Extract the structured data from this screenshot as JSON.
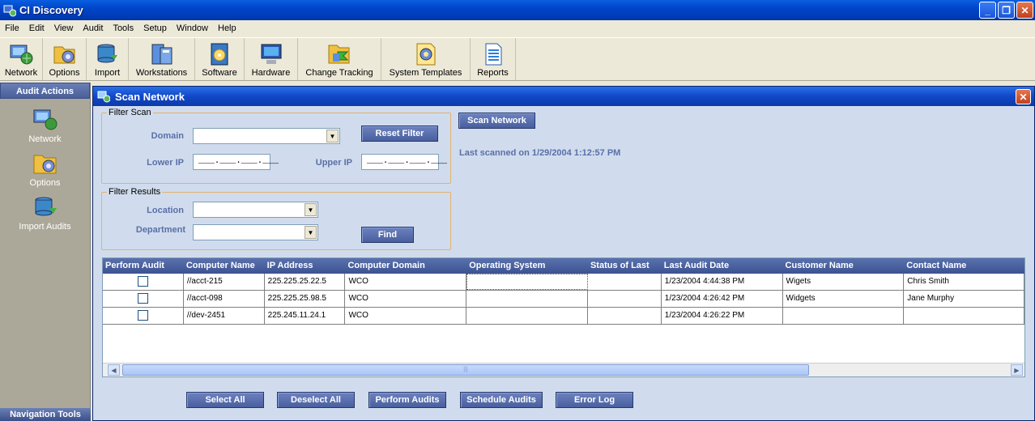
{
  "window": {
    "title": "CI Discovery",
    "minimize": "_",
    "maximize": "❐",
    "close": "✕"
  },
  "menu": [
    "File",
    "Edit",
    "View",
    "Audit",
    "Tools",
    "Setup",
    "Window",
    "Help"
  ],
  "toolbar": {
    "network": "Network",
    "options": "Options",
    "import": "Import",
    "workstations": "Workstations",
    "software": "Software",
    "hardware": "Hardware",
    "change_tracking": "Change Tracking",
    "system_templates": "System Templates",
    "reports": "Reports"
  },
  "left_panel": {
    "header": "Audit Actions",
    "items": [
      "Network",
      "Options",
      "Import Audits"
    ],
    "footer": "Navigation Tools"
  },
  "scan_window": {
    "title": "Scan Network",
    "close": "✕",
    "filter_scan": {
      "legend": "Filter Scan",
      "domain_label": "Domain",
      "domain_value": "",
      "lower_ip_label": "Lower IP",
      "lower_ip_value": "___.___.___.___",
      "upper_ip_label": "Upper IP",
      "upper_ip_value": "___.___.___.___",
      "reset_button": "Reset Filter"
    },
    "filter_results": {
      "legend": "Filter Results",
      "location_label": "Location",
      "location_value": "",
      "department_label": "Department",
      "department_value": "",
      "find_button": "Find"
    },
    "scan_button": "Scan Network",
    "last_scanned": "Last scanned on 1/29/2004 1:12:57 PM",
    "grid": {
      "columns": [
        "Perform Audit",
        "Computer Name",
        "IP Address",
        "Computer Domain",
        "Operating System",
        "Status of Last",
        "Last Audit Date",
        "Customer Name",
        "Contact Name"
      ],
      "rows": [
        {
          "computer": "//acct-215",
          "ip": "225.225.25.22.5",
          "domain": "WCO",
          "os": "",
          "status": "",
          "date": "1/23/2004 4:44:38 PM",
          "customer": "Wigets",
          "contact": "Chris Smith"
        },
        {
          "computer": "//acct-098",
          "ip": "225.225.25.98.5",
          "domain": "WCO",
          "os": "",
          "status": "",
          "date": "1/23/2004 4:26:42 PM",
          "customer": "Widgets",
          "contact": "Jane Murphy"
        },
        {
          "computer": "//dev-2451",
          "ip": "225.245.11.24.1",
          "domain": "WCO",
          "os": "",
          "status": "",
          "date": "1/23/2004 4:26:22 PM",
          "customer": "",
          "contact": ""
        }
      ],
      "scroll_left": "◀",
      "scroll_right": "▶",
      "scroll_grip": "|||"
    },
    "buttons": {
      "select_all": "Select All",
      "deselect_all": "Deselect All",
      "perform_audits": "Perform Audits",
      "schedule_audits": "Schedule Audits",
      "error_log": "Error Log"
    }
  },
  "colors": {
    "title_bar": "#0045c8",
    "window_bg": "#d0dced",
    "button_bg": "#4a5f9e",
    "label_blue": "#5a6fa8",
    "group_border": "#e0b370"
  }
}
